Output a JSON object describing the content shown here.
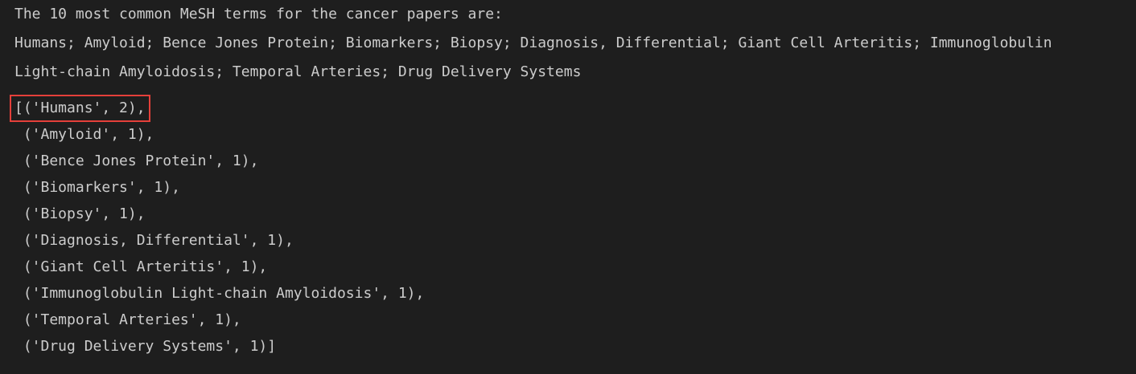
{
  "output": {
    "heading": "The 10 most common MeSH terms for the cancer papers are:",
    "terms_line_1": "Humans; Amyloid; Bence Jones Protein; Biomarkers; Biopsy; Diagnosis, Differential; Giant Cell Arteritis; Immunoglobulin",
    "terms_line_2": "Light-chain Amyloidosis; Temporal Arteries; Drug Delivery Systems",
    "list_rows": [
      "[('Humans', 2),",
      " ('Amyloid', 1),",
      " ('Bence Jones Protein', 1),",
      " ('Biomarkers', 1),",
      " ('Biopsy', 1),",
      " ('Diagnosis, Differential', 1),",
      " ('Giant Cell Arteritis', 1),",
      " ('Immunoglobulin Light-chain Amyloidosis', 1),",
      " ('Temporal Arteries', 1),",
      " ('Drug Delivery Systems', 1)]"
    ]
  },
  "colors": {
    "background": "#1e1e1e",
    "text": "#cccccc",
    "highlight_border": "#e5403a"
  }
}
